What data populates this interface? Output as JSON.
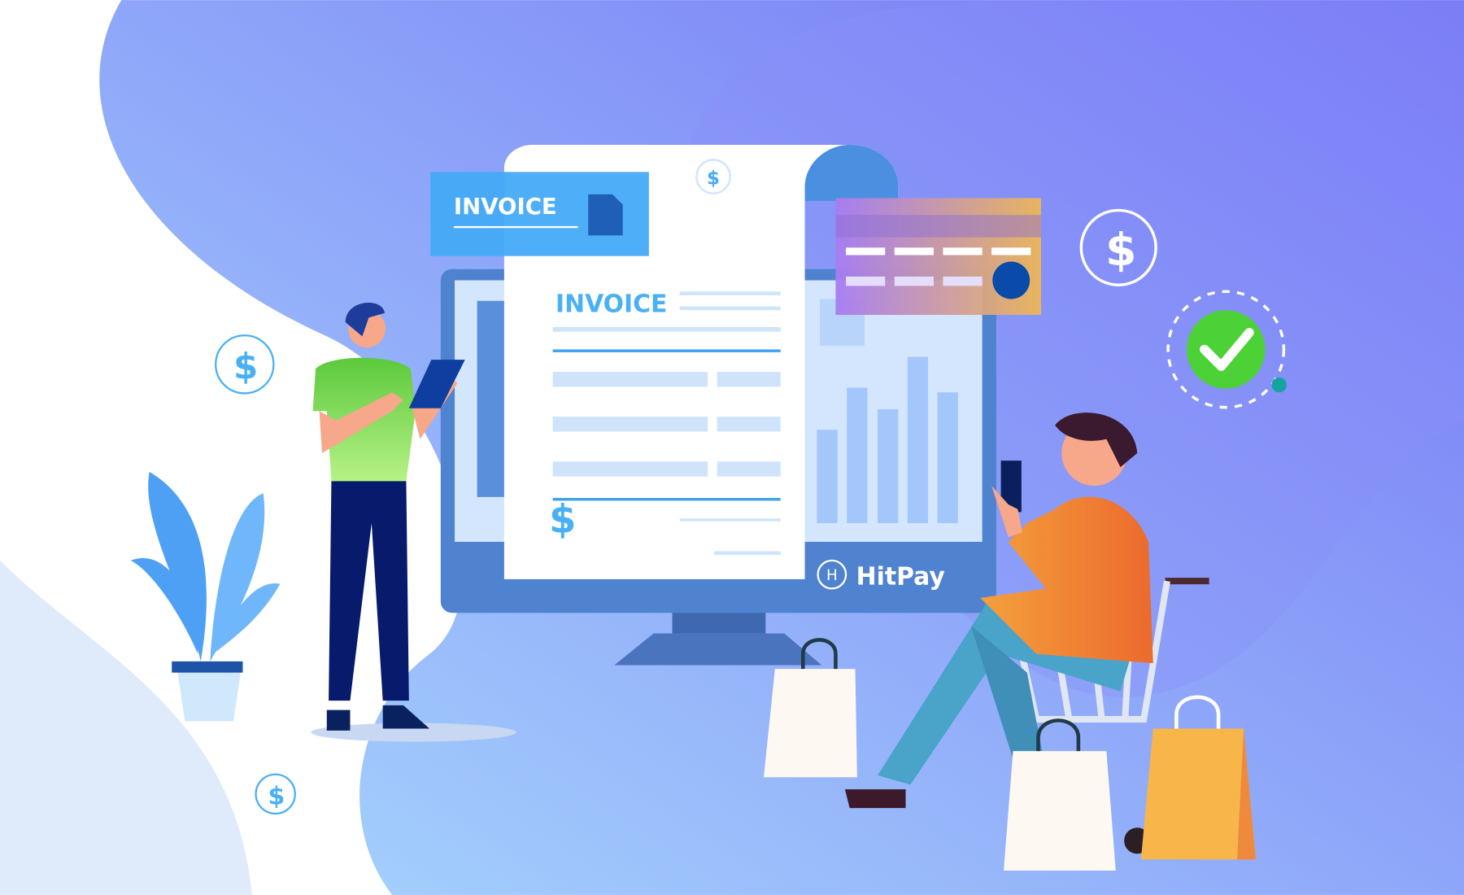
{
  "banner": {
    "invoice_tag_label": "INVOICE",
    "invoice_doc_title": "INVOICE",
    "currency_symbol": "$",
    "brand_name": "HitPay",
    "brand_logo_letter": "H"
  },
  "colors": {
    "background_gradient_start": "#9ec4fb",
    "background_gradient_end": "#7777f5",
    "invoice_tag": "#45aaf7",
    "monitor": "#4f82cf",
    "check_badge": "#4cd137",
    "shopping_bag_orange": "#f7b54a"
  },
  "icons": [
    "dollar-coin-icon",
    "document-icon",
    "credit-card-icon",
    "check-circle-icon",
    "plant-icon",
    "shopping-cart-icon",
    "shopping-bag-icon",
    "smartphone-icon",
    "tablet-icon"
  ]
}
